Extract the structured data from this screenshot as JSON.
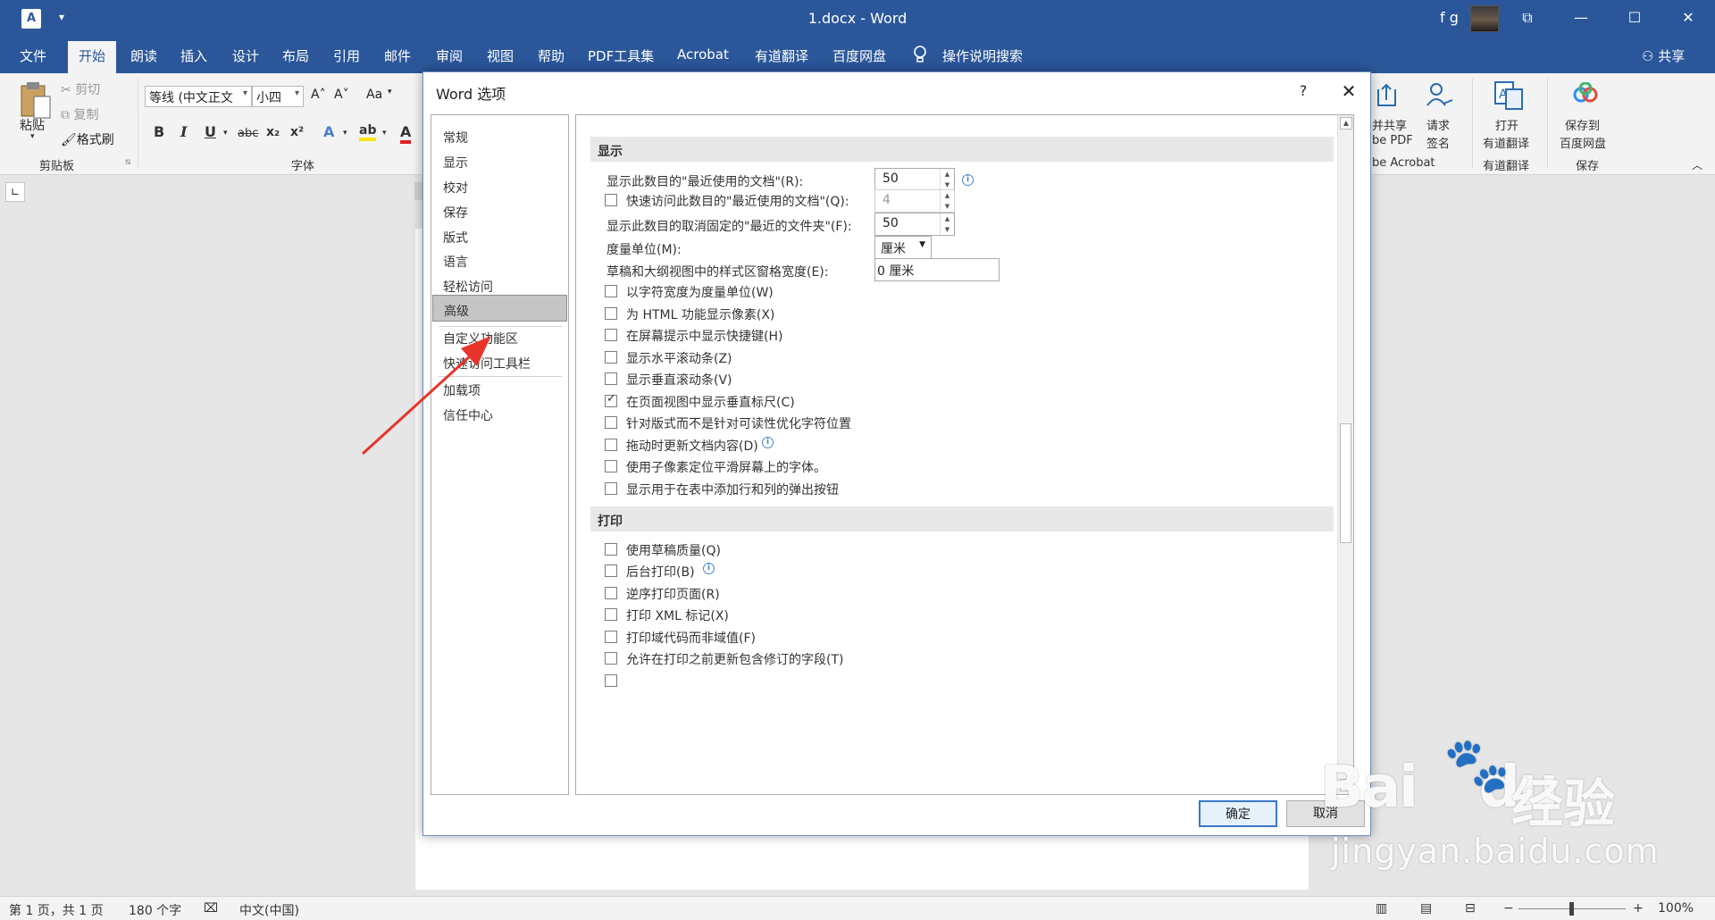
{
  "titlebar": {
    "app_icon": "A",
    "qat_arrow": "▾",
    "title": "1.docx - Word",
    "user": "f g",
    "minimize": "—",
    "maximize": "☐",
    "close": "✕",
    "ribbon_options": "⧉"
  },
  "tabs": [
    "文件",
    "开始",
    "朗读",
    "插入",
    "设计",
    "布局",
    "引用",
    "邮件",
    "审阅",
    "视图",
    "帮助",
    "PDF工具集",
    "Acrobat",
    "有道翻译",
    "百度网盘"
  ],
  "active_tab": "开始",
  "tell_me": "操作说明搜索",
  "share": "共享",
  "ribbon": {
    "clipboard": {
      "paste": "粘贴",
      "cut": "剪切",
      "copy": "复制",
      "format_painter": "格式刷",
      "group": "剪贴板"
    },
    "font": {
      "name": "等线 (中文正文",
      "size": "小四",
      "grow": "A˄",
      "shrink": "A˅",
      "case": "Aa",
      "group": "字体",
      "bold": "B",
      "italic": "I",
      "underline": "U",
      "strike": "abc",
      "subscript": "x₂",
      "superscript": "x²"
    },
    "acrobat": {
      "share": "并共享",
      "share2": "be PDF",
      "sign": "请求",
      "sign2": "签名",
      "group": "be Acrobat"
    },
    "youdao": {
      "open": "打开",
      "open2": "有道翻译",
      "group": "有道翻译"
    },
    "baidu": {
      "save": "保存到",
      "save2": "百度网盘",
      "group": "保存"
    }
  },
  "dialog": {
    "title": "Word 选项",
    "help": "?",
    "close": "✕",
    "nav": [
      "常规",
      "显示",
      "校对",
      "保存",
      "版式",
      "语言",
      "轻松访问",
      "高级",
      "自定义功能区",
      "快速访问工具栏",
      "加载项",
      "信任中心"
    ],
    "nav_selected": "高级",
    "display_section": "显示",
    "recent_docs": {
      "label": "显示此数目的\"最近使用的文档\"(R):",
      "value": "50"
    },
    "quick_access": {
      "label": "快速访问此数目的\"最近使用的文档\"(Q):",
      "value": "4",
      "checked": false
    },
    "unpinned_folders": {
      "label": "显示此数目的取消固定的\"最近的文件夹\"(F):",
      "value": "50"
    },
    "units": {
      "label": "度量单位(M):",
      "value": "厘米"
    },
    "style_width": {
      "label": "草稿和大纲视图中的样式区窗格宽度(E):",
      "value": "0 厘米"
    },
    "display_options": [
      {
        "label": "以字符宽度为度量单位(W)",
        "checked": false
      },
      {
        "label": "为 HTML 功能显示像素(X)",
        "checked": false
      },
      {
        "label": "在屏幕提示中显示快捷键(H)",
        "checked": false
      },
      {
        "label": "显示水平滚动条(Z)",
        "checked": false
      },
      {
        "label": "显示垂直滚动条(V)",
        "checked": false
      },
      {
        "label": "在页面视图中显示垂直标尺(C)",
        "checked": true
      },
      {
        "label": "针对版式而不是针对可读性优化字符位置",
        "checked": false
      },
      {
        "label": "拖动时更新文档内容(D)",
        "checked": false
      },
      {
        "label": "使用子像素定位平滑屏幕上的字体。",
        "checked": false
      },
      {
        "label": "显示用于在表中添加行和列的弹出按钮",
        "checked": false
      }
    ],
    "print_section": "打印",
    "print_options": [
      {
        "label": "使用草稿质量(Q)",
        "checked": false
      },
      {
        "label": "后台打印(B)",
        "checked": false
      },
      {
        "label": "逆序打印页面(R)",
        "checked": false
      },
      {
        "label": "打印 XML 标记(X)",
        "checked": false
      },
      {
        "label": "打印域代码而非域值(F)",
        "checked": false
      },
      {
        "label": "允许在打印之前更新包含修订的字段(T)",
        "checked": false
      }
    ],
    "ok": "确定",
    "cancel": "取消"
  },
  "statusbar": {
    "page": "第 1 页，共 1 页",
    "words": "180 个字",
    "language": "中文(中国)",
    "zoom": "100%",
    "zoom_minus": "−",
    "zoom_plus": "+"
  },
  "watermark": {
    "logo": "Bai",
    "logo2": "du",
    "cn": "经验",
    "url": "jingyan.baidu.com"
  },
  "annotation_color": "#e8332a",
  "accent_color": "#2b579a"
}
